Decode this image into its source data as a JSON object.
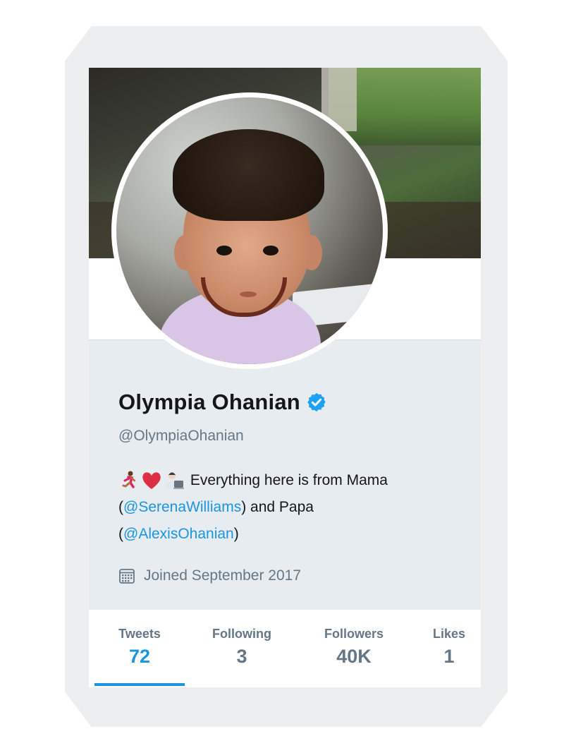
{
  "profile": {
    "name": "Olympia Ohanian",
    "handle": "@OlympiaOhanian",
    "verified": true,
    "bio": {
      "emojis": [
        "runner-emoji",
        "heart-emoji",
        "technologist-emoji"
      ],
      "text_1": "Everything here is from Mama",
      "open_paren_1": "(",
      "mention_1": "@SerenaWilliams",
      "text_2": ") and Papa",
      "open_paren_2": "(",
      "mention_2": "@AlexisOhanian",
      "close_paren_2": ")"
    },
    "joined": "Joined September 2017"
  },
  "stats": [
    {
      "label": "Tweets",
      "value": "72",
      "active": true
    },
    {
      "label": "Following",
      "value": "3",
      "active": false
    },
    {
      "label": "Followers",
      "value": "40K",
      "active": false
    },
    {
      "label": "Likes",
      "value": "1",
      "active": false
    }
  ],
  "colors": {
    "accent": "#1b95e0",
    "secondary_text": "#657786",
    "primary_text": "#14171a",
    "card_bg": "#e6ecf0"
  },
  "icons": {
    "verified": "verified-badge-icon",
    "calendar": "calendar-icon"
  }
}
